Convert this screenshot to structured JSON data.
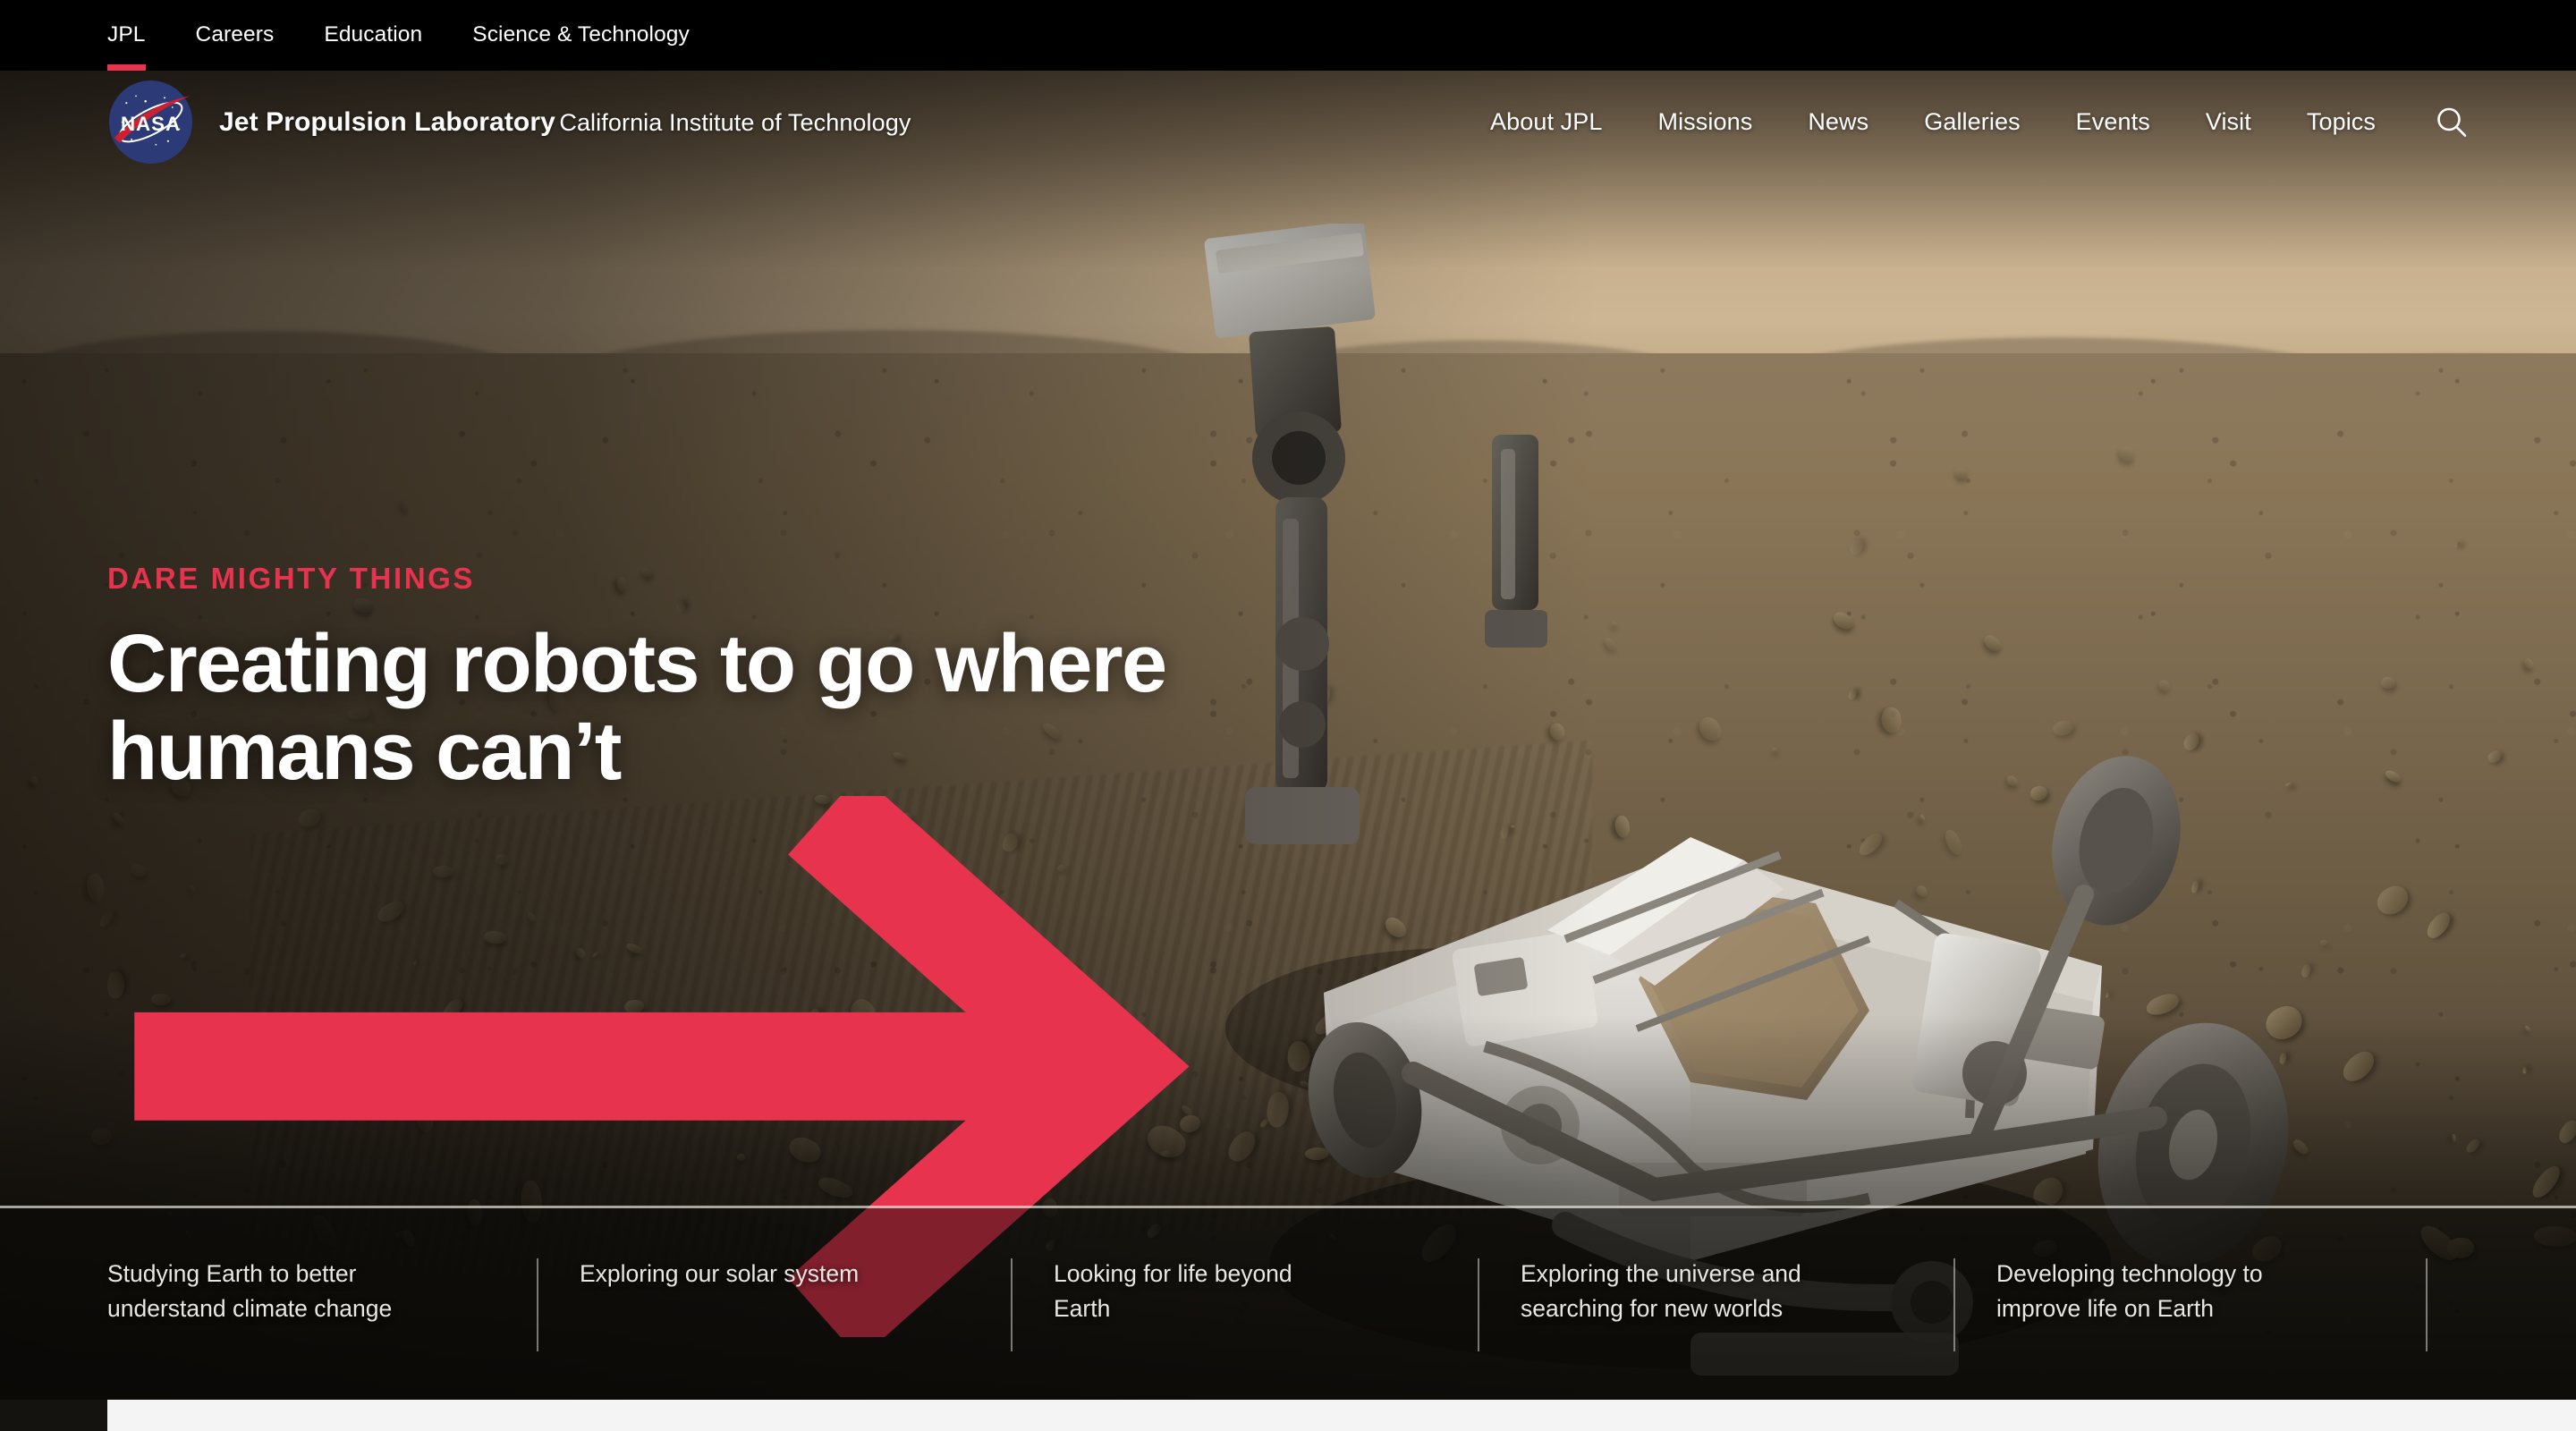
{
  "utility_nav": {
    "items": [
      {
        "label": "JPL",
        "active": true
      },
      {
        "label": "Careers",
        "active": false
      },
      {
        "label": "Education",
        "active": false
      },
      {
        "label": "Science & Technology",
        "active": false
      }
    ],
    "active_underline_color": "#e8334f",
    "background_color": "#000000"
  },
  "brand": {
    "logo": "nasa-meatball-logo",
    "title": "Jet Propulsion Laboratory",
    "subtitle": "California Institute of Technology"
  },
  "main_nav": {
    "items": [
      {
        "label": "About JPL"
      },
      {
        "label": "Missions"
      },
      {
        "label": "News"
      },
      {
        "label": "Galleries"
      },
      {
        "label": "Events"
      },
      {
        "label": "Visit"
      },
      {
        "label": "Topics"
      }
    ],
    "search_icon": "search-icon"
  },
  "hero": {
    "eyebrow": "DARE MIGHTY THINGS",
    "headline": "Creating robots to go where humans can’t",
    "cta_icon": "arrow-right-icon",
    "accent_color": "#e8334f",
    "image_subject": "Perseverance Mars rover selfie on the Martian surface",
    "image_alt": "NASA Perseverance rover on the dusty red surface of Mars under a tan sky"
  },
  "feature_strip": {
    "items": [
      {
        "line1": "Studying Earth to better",
        "line2": "understand climate change"
      },
      {
        "line1": "Exploring our solar system",
        "line2": ""
      },
      {
        "line1": "Looking for life beyond",
        "line2": "Earth"
      },
      {
        "line1": "Exploring the universe and",
        "line2": "searching for new worlds"
      },
      {
        "line1": "Developing technology to",
        "line2": "improve life on Earth"
      }
    ]
  }
}
